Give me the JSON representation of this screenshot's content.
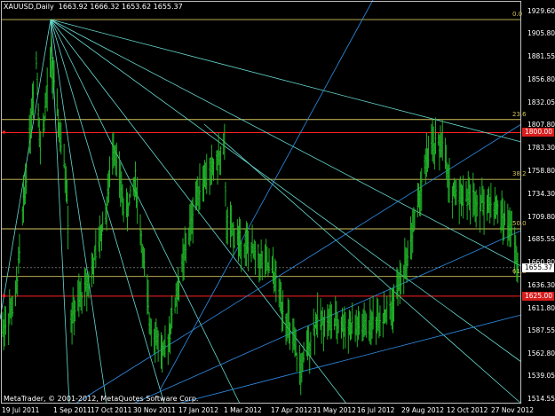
{
  "header": {
    "symbol": "XAUUSD,Daily",
    "ohlc": "1663.92 1666.32 1653.62 1655.37"
  },
  "copyright": "MetaTrader, © 2001-2012, MetaQuotes Software Corp.",
  "y_axis_labels": [
    "1929.60",
    "1905.80",
    "1881.55",
    "1856.80",
    "1832.05",
    "1807.80",
    "1783.30",
    "1758.80",
    "1734.30",
    "1709.80",
    "1685.55",
    "1660.80",
    "1636.30",
    "1611.80",
    "1587.55",
    "1562.80",
    "1539.05",
    "1514.55"
  ],
  "x_axis_labels": [
    "19 Jul 2011",
    "1 Sep 2011",
    "17 Oct 2011",
    "30 Nov 2011",
    "17 Jan 2012",
    "1 Mar 2012",
    "17 Apr 2012",
    "31 May 2012",
    "16 Jul 2012",
    "29 Aug 2012",
    "12 Oct 2012",
    "27 Nov 2012"
  ],
  "fib_levels": [
    {
      "label": "0.0",
      "price": 1921.0
    },
    {
      "label": "23.6",
      "price": 1814.0
    },
    {
      "label": "38.2",
      "price": 1750.0
    },
    {
      "label": "50.0",
      "price": 1697.0
    },
    {
      "label": "61.8",
      "price": 1646.0
    }
  ],
  "price_boxes": [
    {
      "label": "1800.00",
      "price": 1800.0,
      "bg": "#d81e1e",
      "fg": "#ffffff"
    },
    {
      "label": "1655.37",
      "price": 1655.37,
      "bg": "#ffffff",
      "fg": "#000000"
    },
    {
      "label": "1625.00",
      "price": 1625.0,
      "bg": "#d81e1e",
      "fg": "#ffffff"
    }
  ],
  "colors": {
    "background": "#000000",
    "candles": "#22c22b",
    "fib": "#d4c35a",
    "resistance": "#ff2020",
    "trendline_light": "#66d9d0",
    "trendline_blue": "#2e8fe8",
    "axis_text": "#ffffff",
    "frame": "#c0c0c0"
  },
  "chart_data": {
    "type": "candlestick",
    "symbol": "XAUUSD",
    "timeframe": "Daily",
    "last": {
      "open": 1663.92,
      "high": 1666.32,
      "low": 1653.62,
      "close": 1655.37
    },
    "ylim": [
      1510,
      1940
    ],
    "x_range": [
      "19 Jul 2011",
      "end of Dec 2012"
    ],
    "horizontal_levels": [
      1800.0,
      1625.0
    ],
    "close_path": [
      {
        "d": "19 Jul 2011",
        "p": 1590
      },
      {
        "d": "1 Aug 2011",
        "p": 1620
      },
      {
        "d": "12 Aug 2011",
        "p": 1760
      },
      {
        "d": "22 Aug 2011",
        "p": 1880
      },
      {
        "d": "26 Aug 2011",
        "p": 1780
      },
      {
        "d": "6 Sep 2011",
        "p": 1880
      },
      {
        "d": "12 Sep 2011",
        "p": 1820
      },
      {
        "d": "22 Sep 2011",
        "p": 1740
      },
      {
        "d": "26 Sep 2011",
        "p": 1600
      },
      {
        "d": "17 Oct 2011",
        "p": 1650
      },
      {
        "d": "1 Nov 2011",
        "p": 1720
      },
      {
        "d": "8 Nov 2011",
        "p": 1790
      },
      {
        "d": "20 Nov 2011",
        "p": 1710
      },
      {
        "d": "30 Nov 2011",
        "p": 1750
      },
      {
        "d": "14 Dec 2011",
        "p": 1600
      },
      {
        "d": "29 Dec 2011",
        "p": 1560
      },
      {
        "d": "17 Jan 2012",
        "p": 1660
      },
      {
        "d": "1 Feb 2012",
        "p": 1740
      },
      {
        "d": "28 Feb 2012",
        "p": 1780
      },
      {
        "d": "1 Mar 2012",
        "p": 1700
      },
      {
        "d": "17 Apr 2012",
        "p": 1650
      },
      {
        "d": "15 May 2012",
        "p": 1545
      },
      {
        "d": "31 May 2012",
        "p": 1600
      },
      {
        "d": "16 Jul 2012",
        "p": 1590
      },
      {
        "d": "14 Aug 2012",
        "p": 1610
      },
      {
        "d": "29 Aug 2012",
        "p": 1660
      },
      {
        "d": "21 Sep 2012",
        "p": 1780
      },
      {
        "d": "5 Oct 2012",
        "p": 1790
      },
      {
        "d": "12 Oct 2012",
        "p": 1740
      },
      {
        "d": "27 Nov 2012",
        "p": 1720
      },
      {
        "d": "14 Dec 2012",
        "p": 1695
      },
      {
        "d": "20 Dec 2012",
        "p": 1655.37
      }
    ]
  }
}
